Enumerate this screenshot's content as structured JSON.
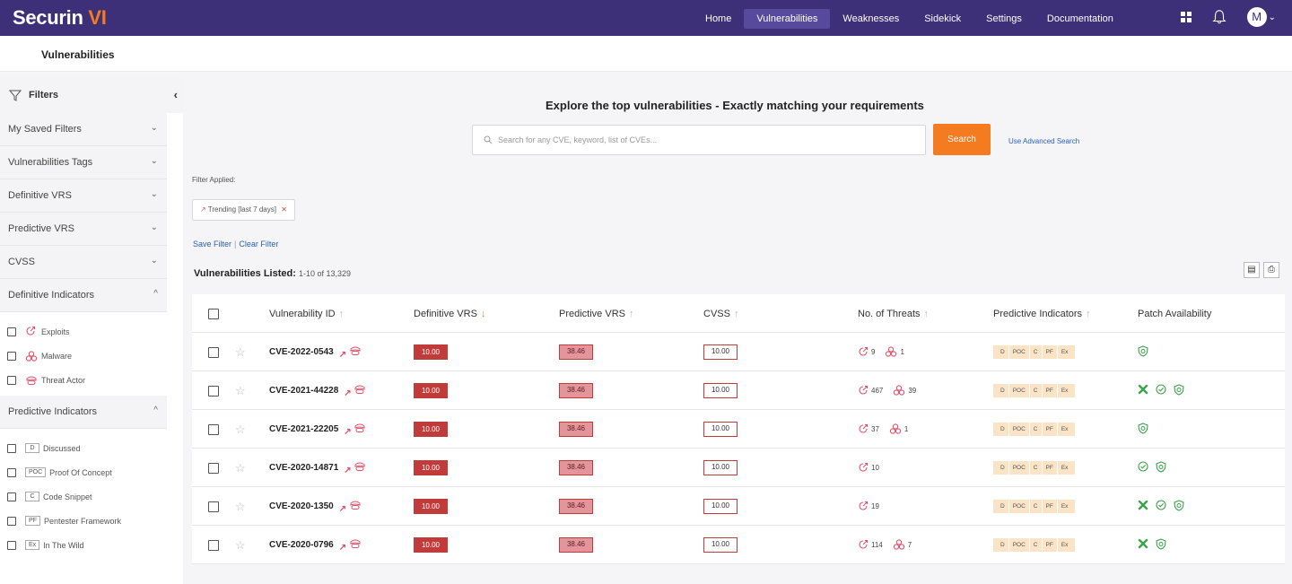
{
  "brand": {
    "name_a": "Securin",
    "name_b": "VI"
  },
  "nav": {
    "items": [
      "Home",
      "Vulnerabilities",
      "Weaknesses",
      "Sidekick",
      "Settings",
      "Documentation"
    ],
    "active": "Vulnerabilities",
    "avatar_letter": "M"
  },
  "breadcrumb": "Vulnerabilities",
  "sidebar": {
    "title": "Filters",
    "sections": [
      "My Saved Filters",
      "Vulnerabilities Tags",
      "Definitive VRS",
      "Predictive VRS",
      "CVSS",
      "Definitive Indicators"
    ],
    "definitive_options": [
      "Exploits",
      "Malware",
      "Threat Actor"
    ],
    "predictive_title": "Predictive Indicators",
    "predictive_options": [
      {
        "tag": "D",
        "label": "Discussed"
      },
      {
        "tag": "POC",
        "label": "Proof Of Concept"
      },
      {
        "tag": "C",
        "label": "Code Snippet"
      },
      {
        "tag": "PF",
        "label": "Pentester Framework"
      },
      {
        "tag": "Ex",
        "label": "In The Wild"
      }
    ]
  },
  "main": {
    "headline": "Explore the top vulnerabilities - Exactly matching your requirements",
    "search_placeholder": "Search for any CVE, keyword, list of CVEs...",
    "search_button": "Search",
    "advanced_link": "Use Advanced Search",
    "filter_applied_label": "Filter Applied:",
    "chip_label": "Trending [last 7 days]",
    "save_filter": "Save Filter",
    "separator": "|",
    "clear_filter": "Clear Filter",
    "listed_label": "Vulnerabilities Listed:",
    "listed_count": "1-10 of 13,329"
  },
  "table": {
    "headers": {
      "id": "Vulnerability ID",
      "dvrs": "Definitive VRS",
      "pvrs": "Predictive VRS",
      "cvss": "CVSS",
      "threats": "No. of Threats",
      "pi": "Predictive Indicators",
      "patch": "Patch Availability"
    },
    "pi_tags": [
      "D",
      "POC",
      "C",
      "PF",
      "Ex"
    ],
    "rows": [
      {
        "id": "CVE-2022-0543",
        "dvrs": "10.00",
        "pvrs": "38.46",
        "cvss": "10.00",
        "exploits": "9",
        "malware": "1",
        "patch": [
          "shield"
        ]
      },
      {
        "id": "CVE-2021-44228",
        "dvrs": "10.00",
        "pvrs": "38.46",
        "cvss": "10.00",
        "exploits": "467",
        "malware": "39",
        "patch": [
          "x",
          "check",
          "shield"
        ]
      },
      {
        "id": "CVE-2021-22205",
        "dvrs": "10.00",
        "pvrs": "38.46",
        "cvss": "10.00",
        "exploits": "37",
        "malware": "1",
        "patch": [
          "shield"
        ]
      },
      {
        "id": "CVE-2020-14871",
        "dvrs": "10.00",
        "pvrs": "38.46",
        "cvss": "10.00",
        "exploits": "10",
        "malware": "",
        "patch": [
          "check",
          "shield"
        ]
      },
      {
        "id": "CVE-2020-1350",
        "dvrs": "10.00",
        "pvrs": "38.46",
        "cvss": "10.00",
        "exploits": "19",
        "malware": "",
        "patch": [
          "x",
          "check",
          "shield"
        ]
      },
      {
        "id": "CVE-2020-0796",
        "dvrs": "10.00",
        "pvrs": "38.46",
        "cvss": "10.00",
        "exploits": "114",
        "malware": "7",
        "patch": [
          "x",
          "shield"
        ]
      }
    ]
  },
  "colors": {
    "nav_bg": "#3d2f78",
    "accent": "#f47b20",
    "danger": "#c23b3b",
    "link": "#2b5fb3",
    "patch_green": "#3ca34a"
  }
}
